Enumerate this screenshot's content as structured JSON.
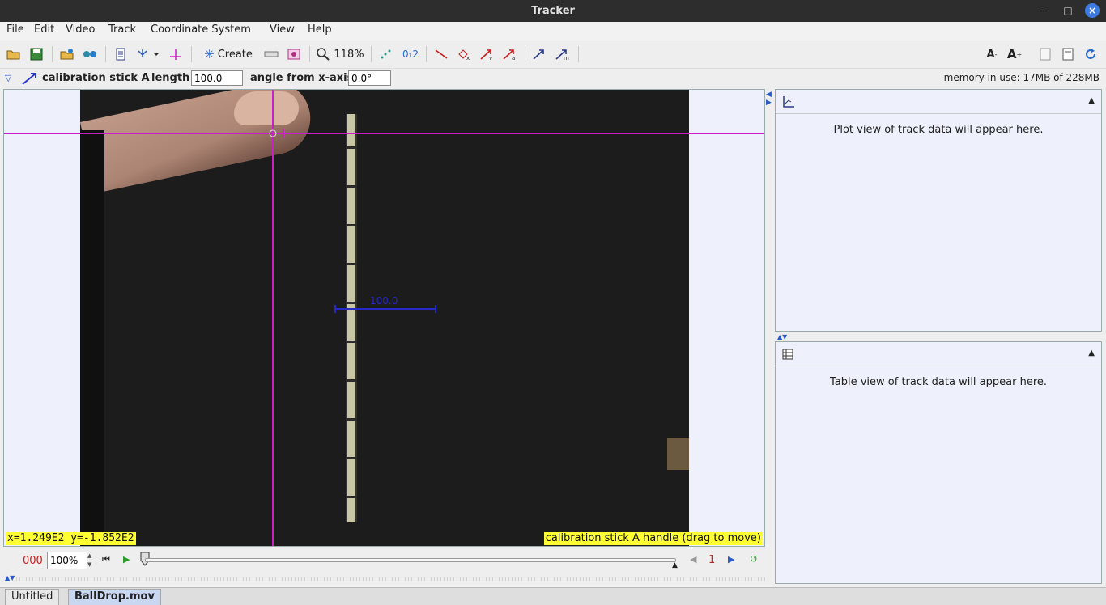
{
  "window": {
    "title": "Tracker"
  },
  "menu": [
    "File",
    "Edit",
    "Video",
    "Track",
    "Coordinate System",
    "View",
    "Help"
  ],
  "toolbar": {
    "create_label": "Create",
    "zoom_label": "118%"
  },
  "trackbar": {
    "track_name": "calibration stick A",
    "length_label": "length",
    "length_value": "100.0",
    "angle_label": "angle from x-axis",
    "angle_value": "0.0°",
    "memory": "memory in use: 17MB of 228MB"
  },
  "viewer": {
    "cal_length_label": "100.0",
    "coordinates": "x=1.249E2  y=-1.852E2",
    "hint": "calibration stick A handle (drag to move)"
  },
  "player": {
    "frame": "000",
    "rate": "100%",
    "step": "1"
  },
  "plot_panel": {
    "message": "Plot view of track data will appear here."
  },
  "table_panel": {
    "message": "Table view of track data will appear here."
  },
  "tabs": [
    "Untitled",
    "BallDrop.mov"
  ],
  "colors": {
    "axes": "#c81fc8",
    "calibration": "#2828c8",
    "hint_bg": "#ffff33"
  }
}
